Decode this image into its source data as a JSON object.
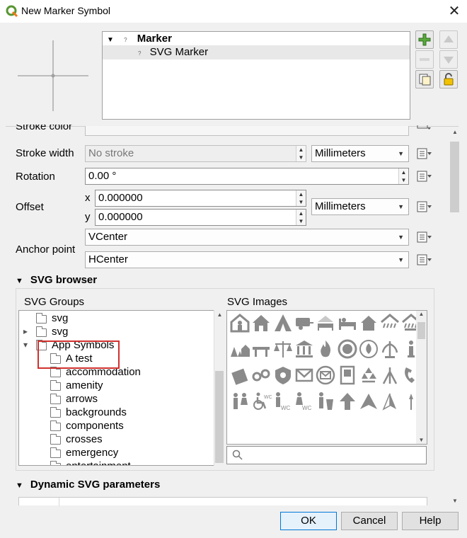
{
  "window": {
    "title": "New Marker Symbol",
    "close_glyph": "✕"
  },
  "layer_tree": {
    "root_label": "Marker",
    "child_label": "SVG Marker"
  },
  "properties": {
    "stroke_color_label": "Stroke color",
    "stroke_width": {
      "label": "Stroke width",
      "value": "No stroke",
      "unit": "Millimeters"
    },
    "rotation": {
      "label": "Rotation",
      "value": "0.00 °"
    },
    "offset": {
      "label": "Offset",
      "x_label": "x",
      "x_value": "0.000000",
      "y_label": "y",
      "y_value": "0.000000",
      "unit": "Millimeters"
    },
    "anchor_point": {
      "label": "Anchor point",
      "vertical": "VCenter",
      "horizontal": "HCenter"
    }
  },
  "svg_browser": {
    "title": "SVG browser",
    "groups_label": "SVG Groups",
    "images_label": "SVG Images",
    "groups": [
      {
        "label": "svg",
        "level": 0,
        "expander": ""
      },
      {
        "label": "svg",
        "level": 0,
        "expander": "▸"
      },
      {
        "label": "App Symbols",
        "level": 0,
        "expander": "▾"
      },
      {
        "label": "A test",
        "level": 1,
        "expander": ""
      },
      {
        "label": "accommodation",
        "level": 1,
        "expander": ""
      },
      {
        "label": "amenity",
        "level": 1,
        "expander": ""
      },
      {
        "label": "arrows",
        "level": 1,
        "expander": ""
      },
      {
        "label": "backgrounds",
        "level": 1,
        "expander": ""
      },
      {
        "label": "components",
        "level": 1,
        "expander": ""
      },
      {
        "label": "crosses",
        "level": 1,
        "expander": ""
      },
      {
        "label": "emergency",
        "level": 1,
        "expander": ""
      },
      {
        "label": "entertainment",
        "level": 1,
        "expander": ""
      }
    ],
    "images": [
      "shelter-icon",
      "house-icon",
      "tent-icon",
      "caravan-icon",
      "bed-house-icon",
      "bed-icon",
      "small-house-icon",
      "shelter-rain-icon",
      "shelter-rain-2-icon",
      "cabin-trees-icon",
      "bench-icon",
      "scales-icon",
      "courthouse-icon",
      "fire-icon",
      "fire-emblem-icon",
      "fire-badge-icon",
      "fountain-icon",
      "info-icon",
      "door-icon",
      "handcuffs-icon",
      "police-badge-icon",
      "envelope-icon",
      "envelope-circle-icon",
      "phone-box-icon",
      "recycle-icon",
      "tripod-icon",
      "phone-icon",
      "toilets-icon",
      "wheelchair-wc-icon",
      "wc-man-icon",
      "wc-woman-icon",
      "bin-icon",
      "arrow-up-icon",
      "arrow-head-icon",
      "north-arrow-icon",
      "thin-arrow-icon"
    ]
  },
  "dynamic_svg": {
    "title": "Dynamic SVG parameters"
  },
  "buttons": {
    "ok": "OK",
    "cancel": "Cancel",
    "help": "Help"
  },
  "colors": {
    "qgis_green": "#589632",
    "highlight_red": "#d0312d",
    "lock_yellow": "#f2c200"
  }
}
